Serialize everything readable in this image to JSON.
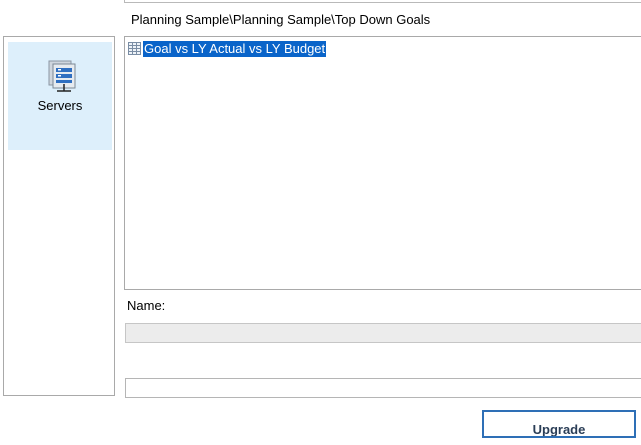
{
  "path": {
    "breadcrumb": "Planning Sample\\Planning Sample\\Top Down Goals"
  },
  "sidebar": {
    "items": [
      {
        "label": "Servers",
        "icon": "server-icon",
        "selected": true
      }
    ]
  },
  "tree": {
    "items": [
      {
        "label": "Goal vs LY Actual vs LY Budget",
        "icon": "grid-icon",
        "selected": true
      }
    ]
  },
  "form": {
    "name_label": "Name:",
    "name_value": "",
    "second_value": ""
  },
  "actions": {
    "upgrade_label": "Upgrade"
  },
  "colors": {
    "selection": "#0a64c9",
    "sidebar_selected": "#ddeffb",
    "button_border": "#2e6fb6"
  }
}
